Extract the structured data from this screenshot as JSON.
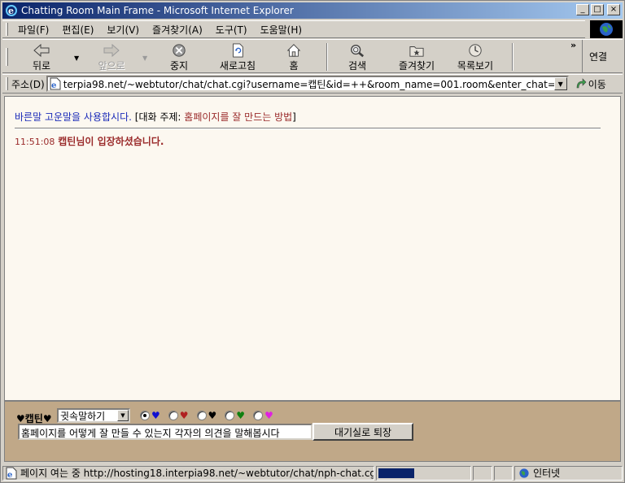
{
  "window": {
    "title": "Chatting Room Main Frame - Microsoft Internet Explorer",
    "controls": {
      "minimize": "_",
      "maximize": "□",
      "close": "×"
    }
  },
  "menu": {
    "items": [
      "파일(F)",
      "편집(E)",
      "보기(V)",
      "즐겨찾기(A)",
      "도구(T)",
      "도움말(H)"
    ]
  },
  "toolbar": {
    "back": "뒤로",
    "forward": "앞으로",
    "stop": "중지",
    "refresh": "새로고침",
    "home": "홈",
    "search": "검색",
    "favorites": "즐겨찾기",
    "history": "목록보기",
    "links": "연결",
    "chevron": "»"
  },
  "address": {
    "label": "주소(D)",
    "url": "terpia98.net/~webtutor/chat/chat.cgi?username=캡틴&id=++&room_name=001.room&enter_chat=홈페이지를",
    "go": "이동"
  },
  "chat": {
    "notice": "바른말 고운말을 사용합시다.",
    "topic_prefix": "[대화 주제: ",
    "topic": "홈페이지를 잘 만드는 방법",
    "topic_suffix": "]",
    "messages": [
      {
        "time": "11:51:08",
        "text": "캡틴님이 입장하셨습니다."
      }
    ]
  },
  "input_frame": {
    "nickname": "♥캡틴♥",
    "mode_selected": "귓속말하기",
    "hearts": [
      {
        "symbol": "♥",
        "color": "#1010d0",
        "checked": true
      },
      {
        "symbol": "♥",
        "color": "#b02020",
        "checked": false
      },
      {
        "symbol": "♥",
        "color": "#000000",
        "checked": false
      },
      {
        "symbol": "♥",
        "color": "#108010",
        "checked": false
      },
      {
        "symbol": "♥",
        "color": "#e020e0",
        "checked": false
      }
    ],
    "message_value": "홈페이지를 어떻게 잘 만들 수 있는지 각자의 의견을 말해봅시다",
    "exit_button": "대기실로 퇴장"
  },
  "status": {
    "text": "페이지 여는 중 http://hosting18.interpia98.net/~webtutor/chat/nph-chat.cgi?us",
    "progress": 0.4,
    "zone": "인터넷"
  },
  "colors": {
    "title_start": "#0a246a",
    "title_end": "#a6caf0",
    "chrome": "#d4d0c8",
    "content_bg": "#fcf8f0",
    "input_bg": "#c0a888",
    "notice": "#1a2ab8",
    "accent_red": "#9a2a2a"
  }
}
